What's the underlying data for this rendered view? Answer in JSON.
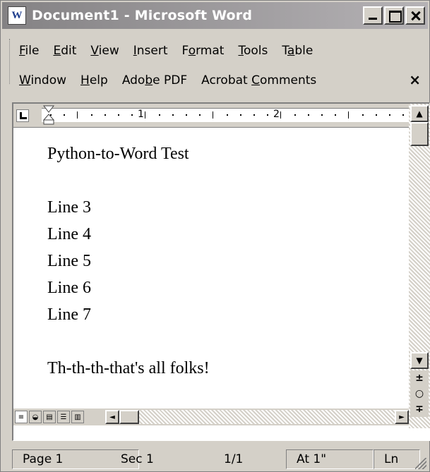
{
  "window": {
    "title": "Document1 - Microsoft Word",
    "app_icon": "W"
  },
  "menu": {
    "row1": [
      {
        "pre": "",
        "u": "F",
        "post": "ile"
      },
      {
        "pre": "",
        "u": "E",
        "post": "dit"
      },
      {
        "pre": "",
        "u": "V",
        "post": "iew"
      },
      {
        "pre": "",
        "u": "I",
        "post": "nsert"
      },
      {
        "pre": "F",
        "u": "o",
        "post": "rmat"
      },
      {
        "pre": "",
        "u": "T",
        "post": "ools"
      },
      {
        "pre": "T",
        "u": "a",
        "post": "ble"
      }
    ],
    "row2": [
      {
        "pre": "",
        "u": "W",
        "post": "indow"
      },
      {
        "pre": "",
        "u": "H",
        "post": "elp"
      },
      {
        "pre": "Ado",
        "u": "b",
        "post": "e PDF"
      },
      {
        "pre": "Acrobat ",
        "u": "C",
        "post": "omments"
      }
    ],
    "close_glyph": "×"
  },
  "ruler": {
    "numbers": [
      "1",
      "2"
    ]
  },
  "document": {
    "lines": [
      "Python-to-Word Test",
      "",
      "Line 3",
      "Line 4",
      "Line 5",
      "Line 6",
      "Line 7",
      "",
      "Th-th-th-that's all folks!"
    ]
  },
  "scrollbar": {
    "up_glyph": "▲",
    "down_glyph": "▼",
    "prev_page_glyph": "±",
    "browse_glyph": "○",
    "next_page_glyph": "∓"
  },
  "statusbar": {
    "page": "Page  1",
    "sec": "Sec  1",
    "pages": "1/1",
    "at": "At  1\"",
    "ln": "Ln"
  },
  "colors": {
    "chrome": "#d4d0c8",
    "title_bar_start": "#848284",
    "title_bar_end": "#b5b2b5",
    "page_bg": "#ffffff"
  }
}
